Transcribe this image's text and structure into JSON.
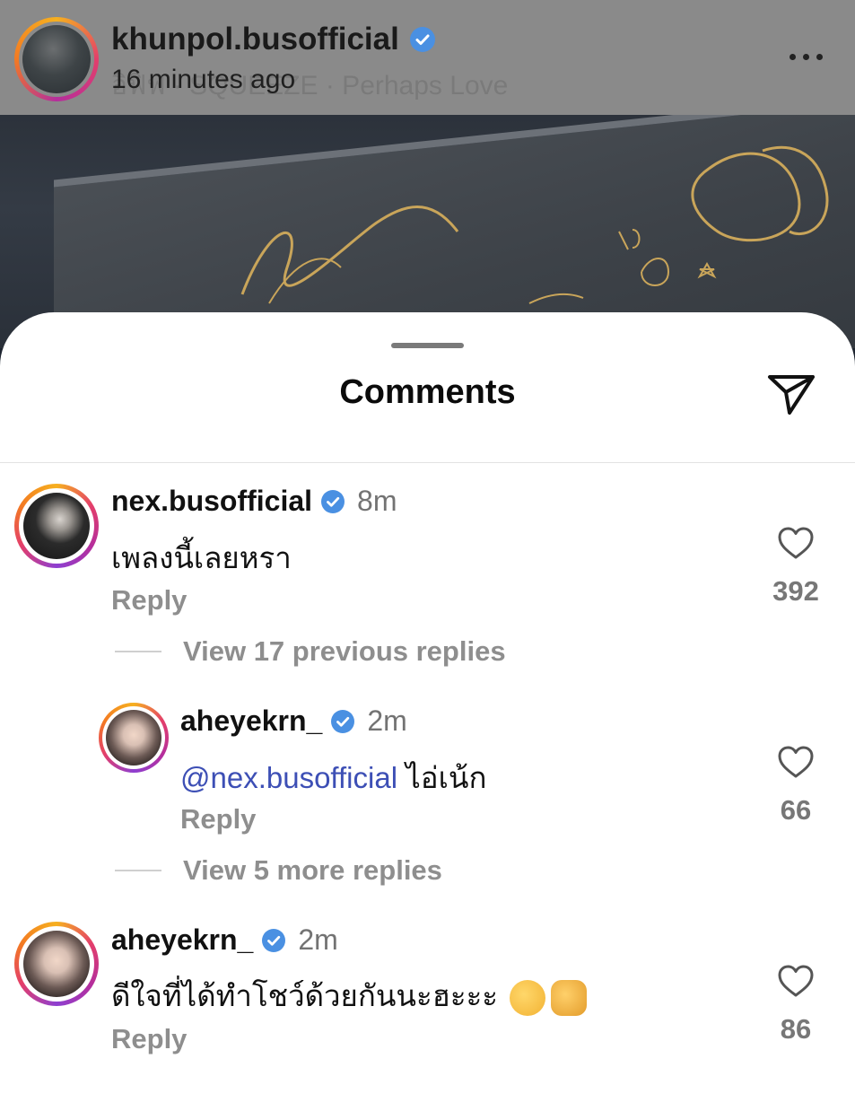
{
  "post": {
    "username": "khunpol.busofficial",
    "music": "อิฟิฟ · SQUEEZE · Perhaps Love",
    "time": "16 minutes ago"
  },
  "sheet": {
    "title": "Comments"
  },
  "comments": [
    {
      "username": "nex.busofficial",
      "time": "8m",
      "text": "เพลงนี้เลยหรา",
      "reply_label": "Reply",
      "likes": "392",
      "view_replies": "View 17 previous replies"
    },
    {
      "username": "aheyekrn_",
      "time": "2m",
      "mention": "@nex.busofficial",
      "text": "ไอ่เน้ก",
      "reply_label": "Reply",
      "likes": "66",
      "view_replies": "View 5 more replies"
    },
    {
      "username": "aheyekrn_",
      "time": "2m",
      "text": "ดีใจที่ได้ทำโชว์ด้วยกันนะฮะะะ",
      "emojis": [
        "face-with-hand-icon",
        "fist-icon"
      ],
      "reply_label": "Reply",
      "likes": "86"
    }
  ],
  "colors": {
    "verified": "#4a90e2",
    "mention": "#3d4fb5",
    "muted": "#8e8e8e"
  }
}
